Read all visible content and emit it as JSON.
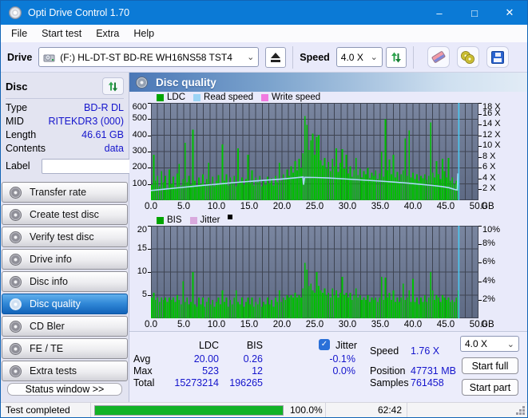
{
  "window": {
    "title": "Opti Drive Control 1.70",
    "controls": {
      "minimize": "–",
      "maximize": "□",
      "close": "✕"
    }
  },
  "menu": {
    "items": [
      "File",
      "Start test",
      "Extra",
      "Help"
    ]
  },
  "toolbar": {
    "drive_label": "Drive",
    "drive_value": "(F:)  HL-DT-ST BD-RE  WH16NS58 TST4",
    "speed_label": "Speed",
    "speed_value": "4.0 X"
  },
  "sidebar": {
    "disc_panel": {
      "title": "Disc",
      "rows": [
        {
          "label": "Type",
          "value": "BD-R DL"
        },
        {
          "label": "MID",
          "value": "RITEKDR3 (000)"
        },
        {
          "label": "Length",
          "value": "46.61 GB"
        },
        {
          "label": "Contents",
          "value": "data"
        }
      ],
      "label_row": {
        "label": "Label",
        "input_value": ""
      }
    },
    "buttons": [
      {
        "label": "Transfer rate",
        "selected": false
      },
      {
        "label": "Create test disc",
        "selected": false
      },
      {
        "label": "Verify test disc",
        "selected": false
      },
      {
        "label": "Drive info",
        "selected": false
      },
      {
        "label": "Disc info",
        "selected": false
      },
      {
        "label": "Disc quality",
        "selected": true
      },
      {
        "label": "CD Bler",
        "selected": false
      },
      {
        "label": "FE / TE",
        "selected": false
      },
      {
        "label": "Extra tests",
        "selected": false
      }
    ],
    "status_window_button": "Status window >>"
  },
  "main": {
    "header_title": "Disc quality"
  },
  "chart_data": [
    {
      "type": "bar",
      "title": "LDC errors vs position with read speed overlay",
      "legend": [
        {
          "label": "LDC",
          "color": "#00a400"
        },
        {
          "label": "Read speed",
          "color": "#9bd4f5"
        },
        {
          "label": "Write speed",
          "color": "#f17ae0"
        }
      ],
      "xlim": [
        0,
        50
      ],
      "x_ticks": [
        0,
        5,
        10,
        15,
        20,
        25,
        30,
        35,
        40,
        45,
        50
      ],
      "x_unit": "GB",
      "x_grid_step": 1,
      "ylim": [
        0,
        600
      ],
      "y_ticks": [
        100,
        200,
        300,
        400,
        500,
        600
      ],
      "right_ticks": [
        2,
        4,
        6,
        8,
        10,
        12,
        14,
        16,
        18
      ],
      "right_unit": " X",
      "right_scale": 33.3333,
      "grid": true,
      "legend_position": "top",
      "bar_step_gb": 0.3,
      "bar_color": "#00c000",
      "values": [
        95,
        280,
        120,
        150,
        85,
        180,
        110,
        150,
        75,
        190,
        100,
        145,
        80,
        165,
        225,
        90,
        130,
        355,
        110,
        150,
        95,
        435,
        120,
        85,
        140,
        100,
        160,
        90,
        130,
        230,
        100,
        145,
        85,
        120,
        155,
        95,
        345,
        120,
        160,
        90,
        140,
        105,
        150,
        85,
        320,
        110,
        140,
        95,
        130,
        280,
        105,
        185,
        90,
        140,
        110,
        150,
        85,
        125,
        95,
        145,
        105,
        135,
        90,
        150,
        110,
        230,
        120,
        160,
        135,
        190,
        150,
        210,
        170,
        240,
        185,
        255,
        200,
        290,
        520,
        465,
        310,
        370,
        410,
        280,
        390,
        400,
        245,
        215,
        260,
        195,
        235,
        180,
        255,
        210,
        320,
        175,
        230,
        315,
        195,
        280,
        165,
        210,
        145,
        185,
        260,
        155,
        195,
        140,
        180,
        160,
        200,
        135,
        170,
        150,
        185,
        130,
        165,
        300,
        145,
        500,
        185,
        250,
        160,
        280,
        140,
        175,
        120,
        160,
        185,
        380,
        150,
        430,
        140,
        170,
        130,
        160,
        120,
        150,
        135,
        160,
        125,
        150,
        480,
        170,
        140,
        240,
        160,
        130,
        255,
        180,
        140,
        260,
        120,
        140,
        100,
        120,
        165
      ],
      "line": {
        "name": "Read speed",
        "color": "#a9d9f7",
        "points": [
          [
            0,
            60
          ],
          [
            2,
            68
          ],
          [
            4,
            76
          ],
          [
            6,
            84
          ],
          [
            8,
            92
          ],
          [
            10,
            99
          ],
          [
            12,
            106
          ],
          [
            14,
            113
          ],
          [
            16,
            119
          ],
          [
            18,
            125
          ],
          [
            20,
            131
          ],
          [
            22,
            138
          ],
          [
            23.2,
            143
          ],
          [
            23.3,
            96
          ],
          [
            23.45,
            141
          ],
          [
            25,
            140
          ],
          [
            27,
            137
          ],
          [
            29,
            133
          ],
          [
            31,
            128
          ],
          [
            33,
            123
          ],
          [
            35,
            118
          ],
          [
            37,
            112
          ],
          [
            39,
            106
          ],
          [
            41,
            99
          ],
          [
            43,
            91
          ],
          [
            44.5,
            84
          ],
          [
            45.5,
            77
          ],
          [
            46.4,
            66
          ],
          [
            46.75,
            63
          ],
          [
            46.85,
            165
          ]
        ]
      },
      "cursor_x": 47.0,
      "cursor_color": "#4ac9f2"
    },
    {
      "type": "bar",
      "title": "BIS errors vs position",
      "legend": [
        {
          "label": "BIS",
          "color": "#00a400"
        },
        {
          "label": "Jitter",
          "color": "#d9a9dd"
        }
      ],
      "legend_marker_color": "#000000",
      "xlim": [
        0,
        50
      ],
      "x_ticks": [
        0,
        5,
        10,
        15,
        20,
        25,
        30,
        35,
        40,
        45,
        50
      ],
      "x_unit": "GB",
      "x_grid_step": 1,
      "ylim": [
        0,
        20
      ],
      "y_ticks": [
        5,
        10,
        15,
        20
      ],
      "right_ticks": [
        2,
        4,
        6,
        8,
        10
      ],
      "right_unit": "%",
      "right_scale": 2,
      "grid": true,
      "legend_position": "top",
      "bar_step_gb": 0.3,
      "bar_color": "#00c000",
      "values": [
        4.5,
        5.5,
        4,
        4.5,
        3.5,
        4.5,
        4,
        4.5,
        3.5,
        4.5,
        4,
        4.5,
        3.5,
        5,
        4,
        3,
        8,
        3.5,
        4.5,
        3,
        3.5,
        10,
        3,
        2.5,
        4.5,
        3,
        4.5,
        2.5,
        3.5,
        4.5,
        3,
        4,
        2.5,
        3.5,
        4.5,
        3,
        6,
        3.5,
        4.5,
        2.5,
        4,
        3,
        4.5,
        6,
        3.5,
        3,
        4.5,
        2.5,
        3.5,
        4.5,
        3,
        4.5,
        2.5,
        3.5,
        3,
        4.5,
        2.5,
        3.5,
        3,
        4.5,
        3,
        4,
        2.5,
        4.5,
        3.5,
        6,
        3.5,
        4.5,
        4,
        5,
        4.5,
        5,
        4.5,
        5.5,
        4.5,
        5,
        4.5,
        6.5,
        12,
        10.5,
        7,
        7.5,
        6,
        5.5,
        10,
        7,
        6,
        5.5,
        6.5,
        5,
        5.5,
        4.5,
        6.5,
        5,
        6,
        4.5,
        5.5,
        9,
        5,
        5.5,
        4.5,
        5.5,
        4,
        5,
        6.5,
        4.5,
        5,
        4,
        4.5,
        4,
        5,
        3.5,
        4.5,
        4,
        4.5,
        3.5,
        4.5,
        9,
        4,
        8.8,
        4.5,
        5.5,
        4,
        6,
        3.5,
        4.5,
        3.5,
        4.5,
        7.5,
        4,
        4.5,
        6,
        3.5,
        8.5,
        3.5,
        4.5,
        3,
        4.5,
        3.5,
        5,
        3.5,
        4.5,
        10,
        6,
        4,
        5,
        4.5,
        3.5,
        5,
        4.5,
        4,
        4.5,
        3.5,
        4,
        3.5,
        4.5,
        6
      ],
      "cursor_x": 47.0,
      "cursor_color": "#4ac9f2"
    }
  ],
  "results": {
    "col_headers": {
      "ldc": "LDC",
      "bis": "BIS"
    },
    "rows": [
      {
        "label": "Avg",
        "ldc": "20.00",
        "bis": "0.26",
        "jitter": "-0.1%"
      },
      {
        "label": "Max",
        "ldc": "523",
        "bis": "12",
        "jitter": "0.0%"
      },
      {
        "label": "Total",
        "ldc": "15273214",
        "bis": "196265",
        "jitter": ""
      }
    ],
    "jitter_checkbox_label": "Jitter",
    "jitter_checked": true,
    "stats": [
      {
        "label": "Speed",
        "value": "1.76 X"
      },
      {
        "label": "Position",
        "value": "47731 MB"
      },
      {
        "label": "Samples",
        "value": "761458"
      }
    ],
    "speed_select_value": "4.0 X",
    "start_full_label": "Start full",
    "start_part_label": "Start part"
  },
  "statusbar": {
    "status_text": "Test completed",
    "progress_percent": "100.0%",
    "progress_value": 100,
    "elapsed_time": "62:42"
  },
  "colors": {
    "titlebar": "#0b7ad6",
    "plot_bg_top": "#7a86a0",
    "plot_bg_bottom": "#5e6a84",
    "grid": "#3e4452",
    "bar_green": "#00c000",
    "read_speed_line": "#a9d9f7",
    "cursor_blue": "#4ac9f2",
    "value_blue": "#1414cc",
    "progress_green": "#12b226"
  }
}
